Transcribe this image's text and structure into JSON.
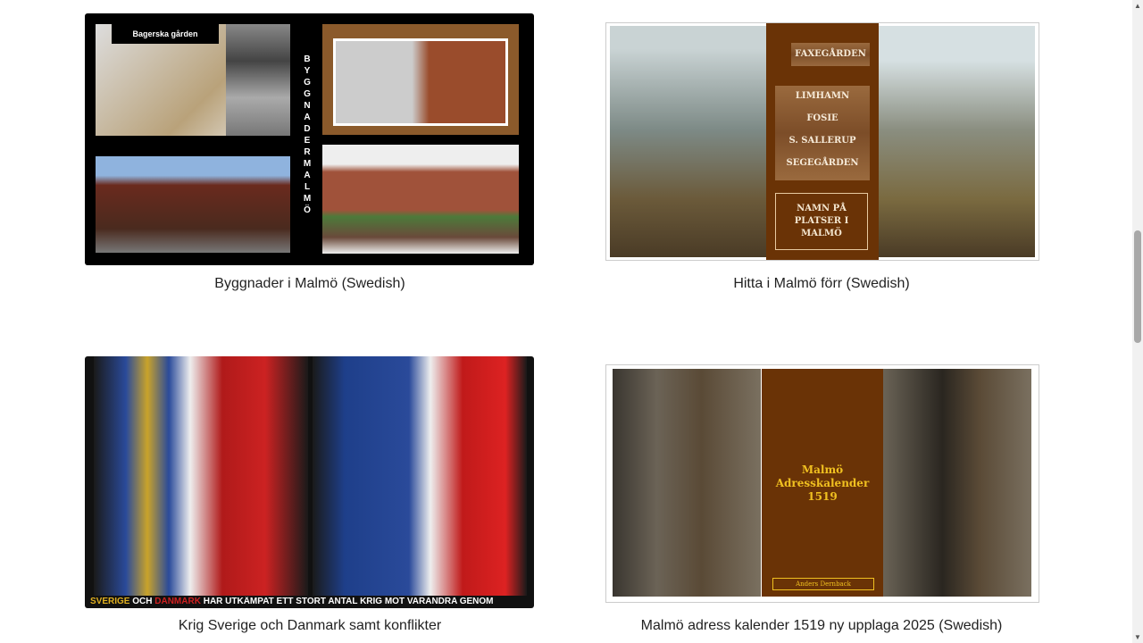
{
  "books": [
    {
      "caption": "Byggnader i Malmö (Swedish)",
      "cover_text": {
        "label": "Bagerska gården",
        "vertical": "BYGGNADER MALMÖ"
      }
    },
    {
      "caption": "Hitta i Malmö förr (Swedish)",
      "cover_text": {
        "arrow": "FAXEGÅRDEN",
        "places": [
          "LIMHAMN",
          "FOSIE",
          "S. SALLERUP",
          "SEGEGÅRDEN"
        ],
        "title": "NAMN PÅ PLATSER I MALMÖ"
      }
    },
    {
      "caption": "Krig Sverige och Danmark samt konflikter",
      "cover_text": {
        "word1": "Sverige",
        "word2": "och",
        "word3": "Danmark",
        "rest": "har utkämpat ett stort antal krig mot varandra genom"
      }
    },
    {
      "caption": "Malmö adress kalender 1519 ny upplaga 2025 (Swedish)",
      "cover_text": {
        "title": "Malmö Adresskalender 1519",
        "author": "Anders Dernback"
      }
    }
  ],
  "scrollbar": {
    "position_fraction": 0.3
  }
}
